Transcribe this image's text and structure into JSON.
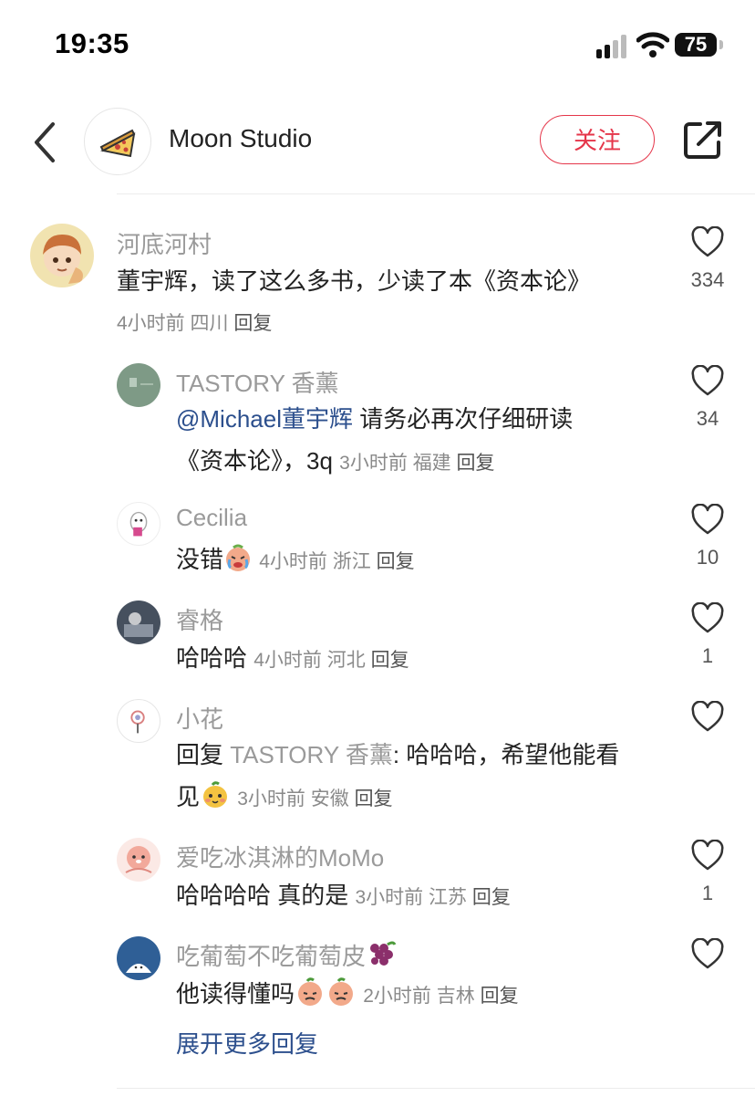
{
  "status_bar": {
    "time": "19:35",
    "battery": "75"
  },
  "header": {
    "title": "Moon Studio",
    "follow_label": "关注"
  },
  "comment_main": {
    "name": "河底河村",
    "text": "董宇辉，读了这么多书，少读了本《资本论》",
    "time": "4小时前",
    "location": "四川",
    "reply": "回复",
    "likes": "334"
  },
  "replies": [
    {
      "name": "TASTORY 香薰",
      "mention": "@Michael董宇辉",
      "text_line1": " 请务必再次仔细研读",
      "text_line2": "《资本论》，3q",
      "time": "3小时前",
      "location": "福建",
      "reply": "回复",
      "likes": "34"
    },
    {
      "name": "Cecilia",
      "text": "没错",
      "time": "4小时前",
      "location": "浙江",
      "reply": "回复",
      "likes": "10"
    },
    {
      "name": "睿格",
      "text": "哈哈哈",
      "time": "4小时前",
      "location": "河北",
      "reply": "回复",
      "likes": "1"
    },
    {
      "name": "小花",
      "reply_prefix": "回复 ",
      "reply_to": "TASTORY 香薰",
      "text_line1": ": 哈哈哈，希望他能看",
      "text_line2": "见",
      "time": "3小时前",
      "location": "安徽",
      "reply": "回复",
      "likes": ""
    },
    {
      "name": "爱吃冰淇淋的MoMo",
      "text": "哈哈哈哈 真的是",
      "time": "3小时前",
      "location": "江苏",
      "reply": "回复",
      "likes": "1"
    },
    {
      "name": "吃葡萄不吃葡萄皮",
      "text": "他读得懂吗",
      "time": "2小时前",
      "location": "吉林",
      "reply": "回复",
      "likes": ""
    }
  ],
  "expand_more": "展开更多回复",
  "icons": [
    "back-icon",
    "share-icon",
    "heart-icon",
    "signal-icon",
    "wifi-icon",
    "battery-icon"
  ],
  "colors": {
    "accent": "#e5364a",
    "link": "#2c4f8d"
  }
}
